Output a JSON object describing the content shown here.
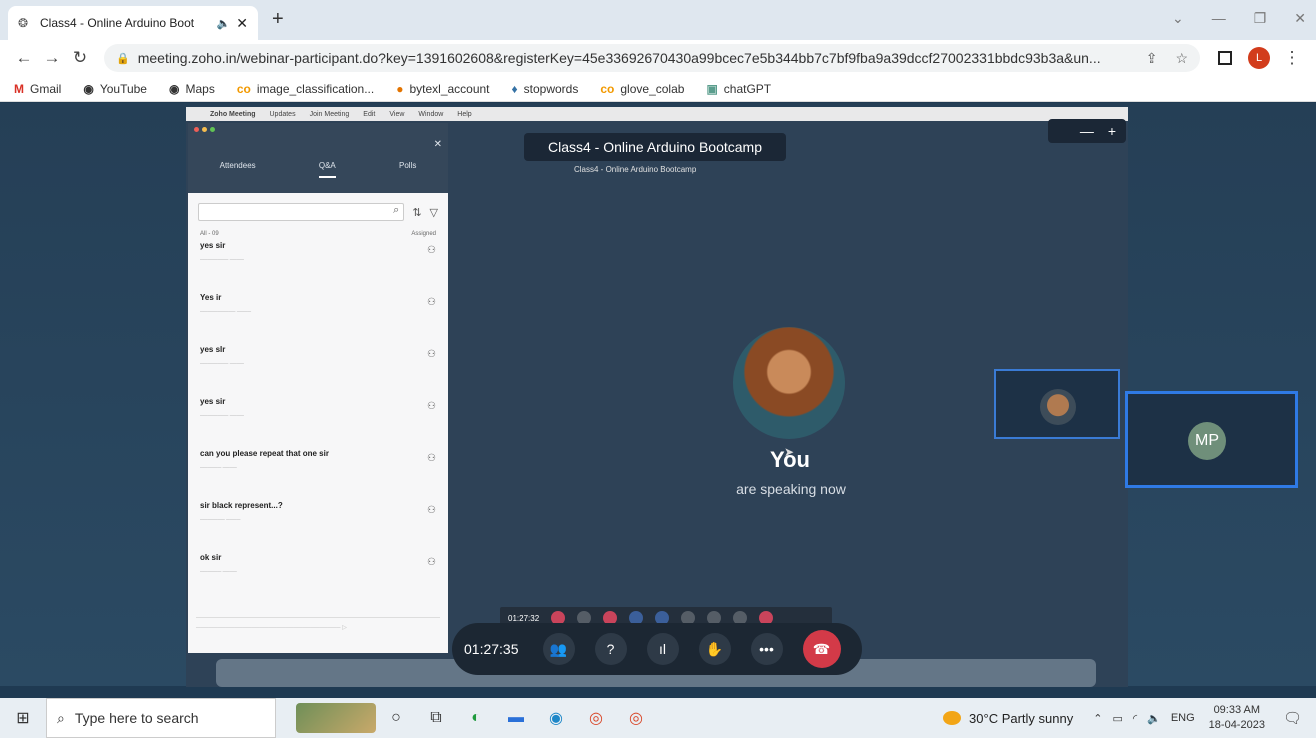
{
  "browser": {
    "tab_title": "Class4 - Online Arduino Boot",
    "new_tab": "+",
    "url": "meeting.zoho.in/webinar-participant.do?key=1391602608&registerKey=45e33692670430a99bcec7e5b344bb7c7bf9fba9a39dccf27002331bbdc93b3a&un...",
    "profile_initial": "L",
    "bookmarks": [
      {
        "label": "Gmail",
        "icon": "gmail-icon"
      },
      {
        "label": "YouTube",
        "icon": "globe-icon"
      },
      {
        "label": "Maps",
        "icon": "globe-icon"
      },
      {
        "label": "image_classification...",
        "icon": "colab-icon"
      },
      {
        "label": "bytexl_account",
        "icon": "circle-icon"
      },
      {
        "label": "stopwords",
        "icon": "python-icon"
      },
      {
        "label": "glove_colab",
        "icon": "colab-icon"
      },
      {
        "label": "chatGPT",
        "icon": "chat-icon"
      }
    ]
  },
  "mac_menu": [
    "Zoho Meeting",
    "Updates",
    "Join Meeting",
    "Edit",
    "View",
    "Window",
    "Help"
  ],
  "qa_panel": {
    "tabs": [
      "Attendees",
      "Q&A",
      "Polls"
    ],
    "filter_label": "All - 09",
    "assigned_label": "Assigned",
    "items": [
      {
        "text": "yes sir"
      },
      {
        "text": "Yes ir"
      },
      {
        "text": "yes slr"
      },
      {
        "text": "yes sir"
      },
      {
        "text": "can you please repeat that one sir"
      },
      {
        "text": "sir black represent...?"
      },
      {
        "text": "ok sir"
      }
    ]
  },
  "meeting": {
    "title": "Class4 - Online Arduino Bootcamp",
    "subtitle": "Class4 - Online Arduino Bootcamp",
    "speaker_label": "You",
    "speaker_status": "are speaking now",
    "mini_timer": "01:27:32",
    "timer": "01:27:35",
    "participant_initials": "MP"
  },
  "taskbar": {
    "search_placeholder": "Type here to search",
    "weather": "30°C  Partly sunny",
    "lang": "ENG",
    "time": "09:33 AM",
    "date": "18-04-2023"
  }
}
